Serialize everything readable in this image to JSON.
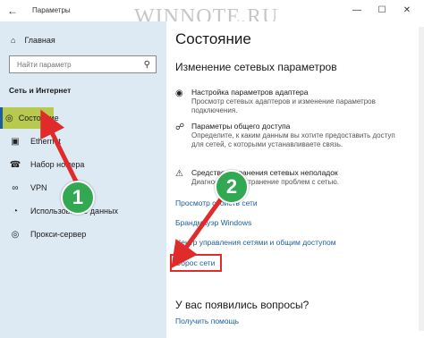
{
  "window": {
    "title": "Параметры",
    "controls": [
      "—",
      "☐",
      "✕"
    ]
  },
  "watermark": "WINNOTE.RU",
  "sidebar": {
    "home_label": "Главная",
    "search_placeholder": "Найти параметр",
    "section_heading": "Сеть и Интернет",
    "items": [
      {
        "label": "Состояние",
        "icon": "globe-icon",
        "active": true
      },
      {
        "label": "Ethernet",
        "icon": "ethernet-icon",
        "active": false
      },
      {
        "label": "Набор номера",
        "icon": "dialup-icon",
        "active": false
      },
      {
        "label": "VPN",
        "icon": "vpn-icon",
        "active": false
      },
      {
        "label": "Использование данных",
        "icon": "data-usage-icon",
        "active": false
      },
      {
        "label": "Прокси-сервер",
        "icon": "globe-icon",
        "active": false
      }
    ]
  },
  "main": {
    "title": "Состояние",
    "subheading": "Изменение сетевых параметров",
    "options": [
      {
        "title": "Настройка параметров адаптера",
        "desc": "Просмотр сетевых адаптеров и изменение параметров подключения.",
        "icon": "adapter-icon"
      },
      {
        "title": "Параметры общего доступа",
        "desc": "Определите, к каким данным вы хотите предоставить доступ для сетей, с которыми устанавливаете связь.",
        "icon": "share-icon"
      },
      {
        "title": "Средство устранения сетевых неполадок",
        "desc": "Диагностика и устранение проблем с сетью.",
        "icon": "warning-icon"
      }
    ],
    "links": [
      "Просмотр свойств сети",
      "Брандмауэр Windows",
      "Центр управления сетями и общим доступом",
      "Сброс сети"
    ],
    "questions_heading": "У вас появились вопросы?",
    "help_link": "Получить помощь"
  },
  "annotations": {
    "badge_1": "1",
    "badge_2": "2",
    "arrow_color": "#e12b2b",
    "badge_color": "#32a852"
  }
}
